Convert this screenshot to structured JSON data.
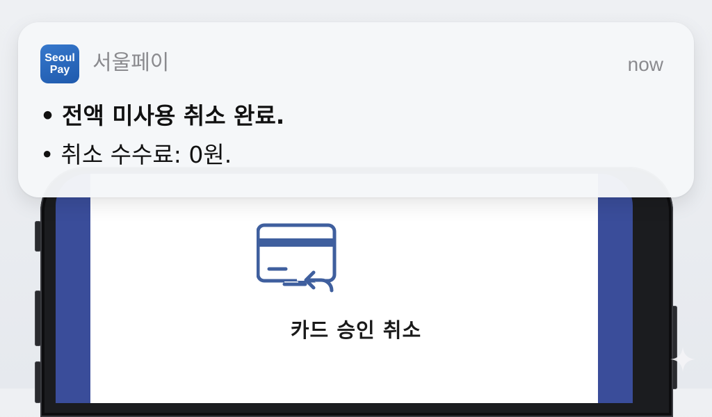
{
  "notification": {
    "app_icon_text_top": "Seoul",
    "app_icon_text_bottom": "Pay",
    "app_name": "서울페이",
    "timestamp": "now",
    "bullet": "•",
    "lines": [
      "전액 미사용 취소 완료.",
      "취소 수수료: 0원."
    ]
  },
  "screen": {
    "icon": "card-cancel-icon",
    "title": "카드 승인 취소"
  },
  "icons": {
    "app": "seoul-pay-app-icon",
    "sparkle": "sparkle-icon"
  },
  "colors": {
    "brand_blue": "#2a69bf",
    "screen_accent": "#3a4d9a",
    "icon_stroke": "#3f5f9e"
  }
}
